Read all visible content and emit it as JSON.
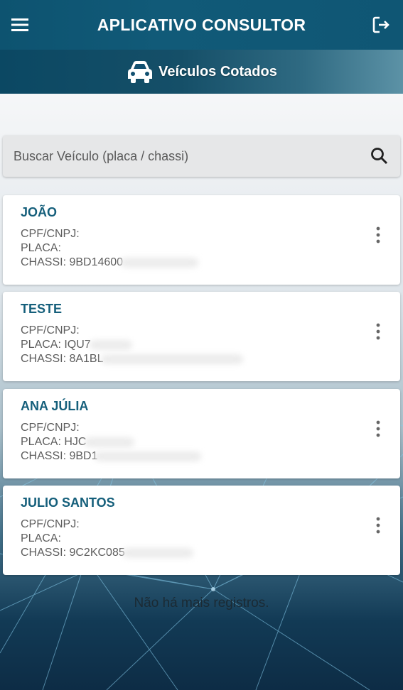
{
  "header": {
    "title": "APLICATIVO CONSULTOR",
    "menu_icon": "menu-icon",
    "logout_icon": "logout-icon"
  },
  "subheader": {
    "label": "Veículos Cotados",
    "icon": "car-icon"
  },
  "search": {
    "placeholder": "Buscar Veículo (placa / chassi)",
    "value": "",
    "icon": "search-icon"
  },
  "vehicles": [
    {
      "name": "JOÃO",
      "cpf_label": "CPF/CNPJ:",
      "placa_label": "PLACA:",
      "chassi_label": "CHASSI: 9BD14600"
    },
    {
      "name": "TESTE",
      "cpf_label": "CPF/CNPJ:",
      "placa_label": "PLACA: IQU7",
      "chassi_label": "CHASSI: 8A1BL"
    },
    {
      "name": "ANA JÚLIA",
      "cpf_label": "CPF/CNPJ:",
      "placa_label": "PLACA: HJC",
      "chassi_label": "CHASSI: 9BD1"
    },
    {
      "name": "JULIO SANTOS",
      "cpf_label": "CPF/CNPJ:",
      "placa_label": "PLACA:",
      "chassi_label": "CHASSI: 9C2KC085"
    }
  ],
  "footer": {
    "text": "Não há mais registros."
  },
  "colors": {
    "primary": "#0f5674",
    "name_text": "#155f7b",
    "card_bg": "#ffffff"
  }
}
